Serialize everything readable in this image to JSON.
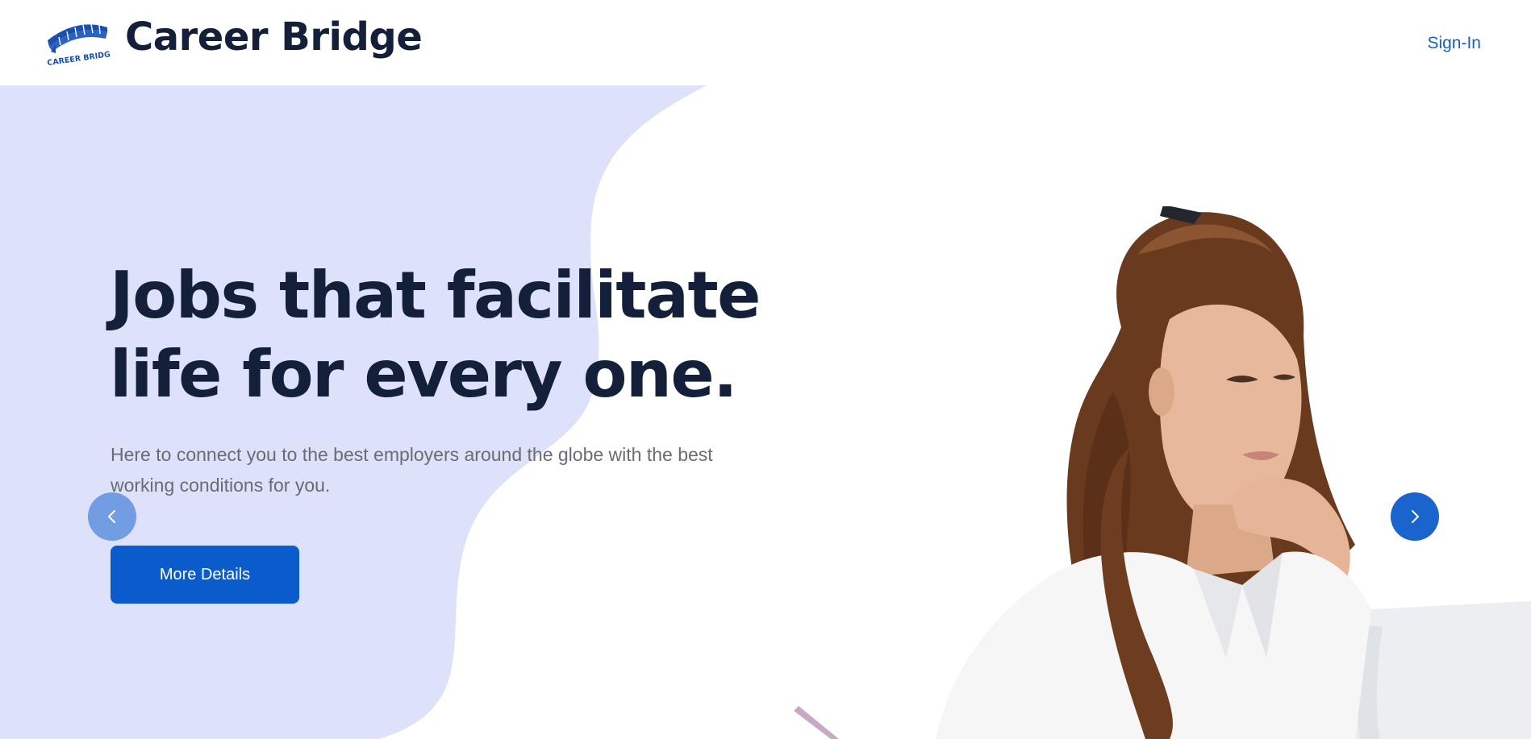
{
  "header": {
    "brand": "Career Bridge",
    "logo_text": "CAREER BRIDGE",
    "signin_label": "Sign-In"
  },
  "hero": {
    "headline_line1": "Jobs that facilitate",
    "headline_line2": "life for every one.",
    "subtext": "Here to connect you to the best employers around the globe with the best working conditions for you.",
    "cta_label": "More Details"
  },
  "carousel": {
    "prev_icon": "chevron-left-icon",
    "next_icon": "chevron-right-icon"
  },
  "colors": {
    "brand_dark": "#14203a",
    "accent_blue": "#0a5ccc",
    "link_blue": "#1a5fbf",
    "blob_lavender": "#dde2fa",
    "subtext_gray": "#6b6b73"
  }
}
